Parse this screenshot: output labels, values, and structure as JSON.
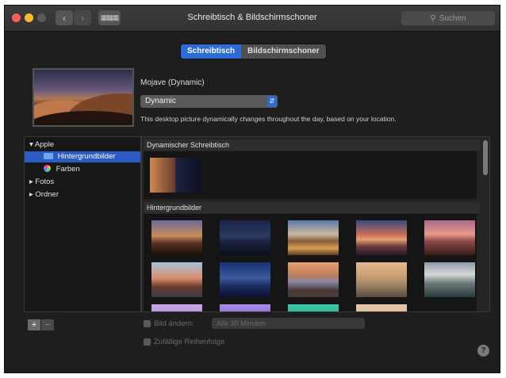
{
  "window": {
    "title": "Schreibtisch & Bildschirmschoner"
  },
  "toolbar": {
    "back_icon": "chevron-left-icon",
    "forward_icon": "chevron-right-icon",
    "grid_icon": "grid-icon"
  },
  "search": {
    "placeholder": "Suchen"
  },
  "tabs": [
    {
      "label": "Schreibtisch",
      "active": true
    },
    {
      "label": "Bildschirmschoner",
      "active": false
    }
  ],
  "current": {
    "name": "Mojave (Dynamic)",
    "mode": "Dynamic",
    "description": "This desktop picture dynamically changes throughout the day, based on your location."
  },
  "sidebar": {
    "items": [
      {
        "label": "Apple",
        "disclosure": "▾"
      },
      {
        "label": "Hintergrundbilder",
        "selected": true
      },
      {
        "label": "Farben"
      },
      {
        "label": "Fotos",
        "disclosure": "▸"
      },
      {
        "label": "Ordner",
        "disclosure": "▸"
      }
    ]
  },
  "sections": {
    "dynamic": "Dynamischer Schreibtisch",
    "wallpapers": "Hintergrundbilder"
  },
  "bottom": {
    "add": "+",
    "remove": "−",
    "change_picture": "Bild ändern:",
    "interval": "Alle 30 Minuten",
    "random_order": "Zufällige Reihenfolge",
    "help": "?"
  },
  "colors": {
    "accent": "#2c6bd8",
    "window_bg": "#1e1e1e",
    "close": "#fc5f57",
    "minimize": "#fdbc2e",
    "zoom": "#5a5a5a"
  }
}
